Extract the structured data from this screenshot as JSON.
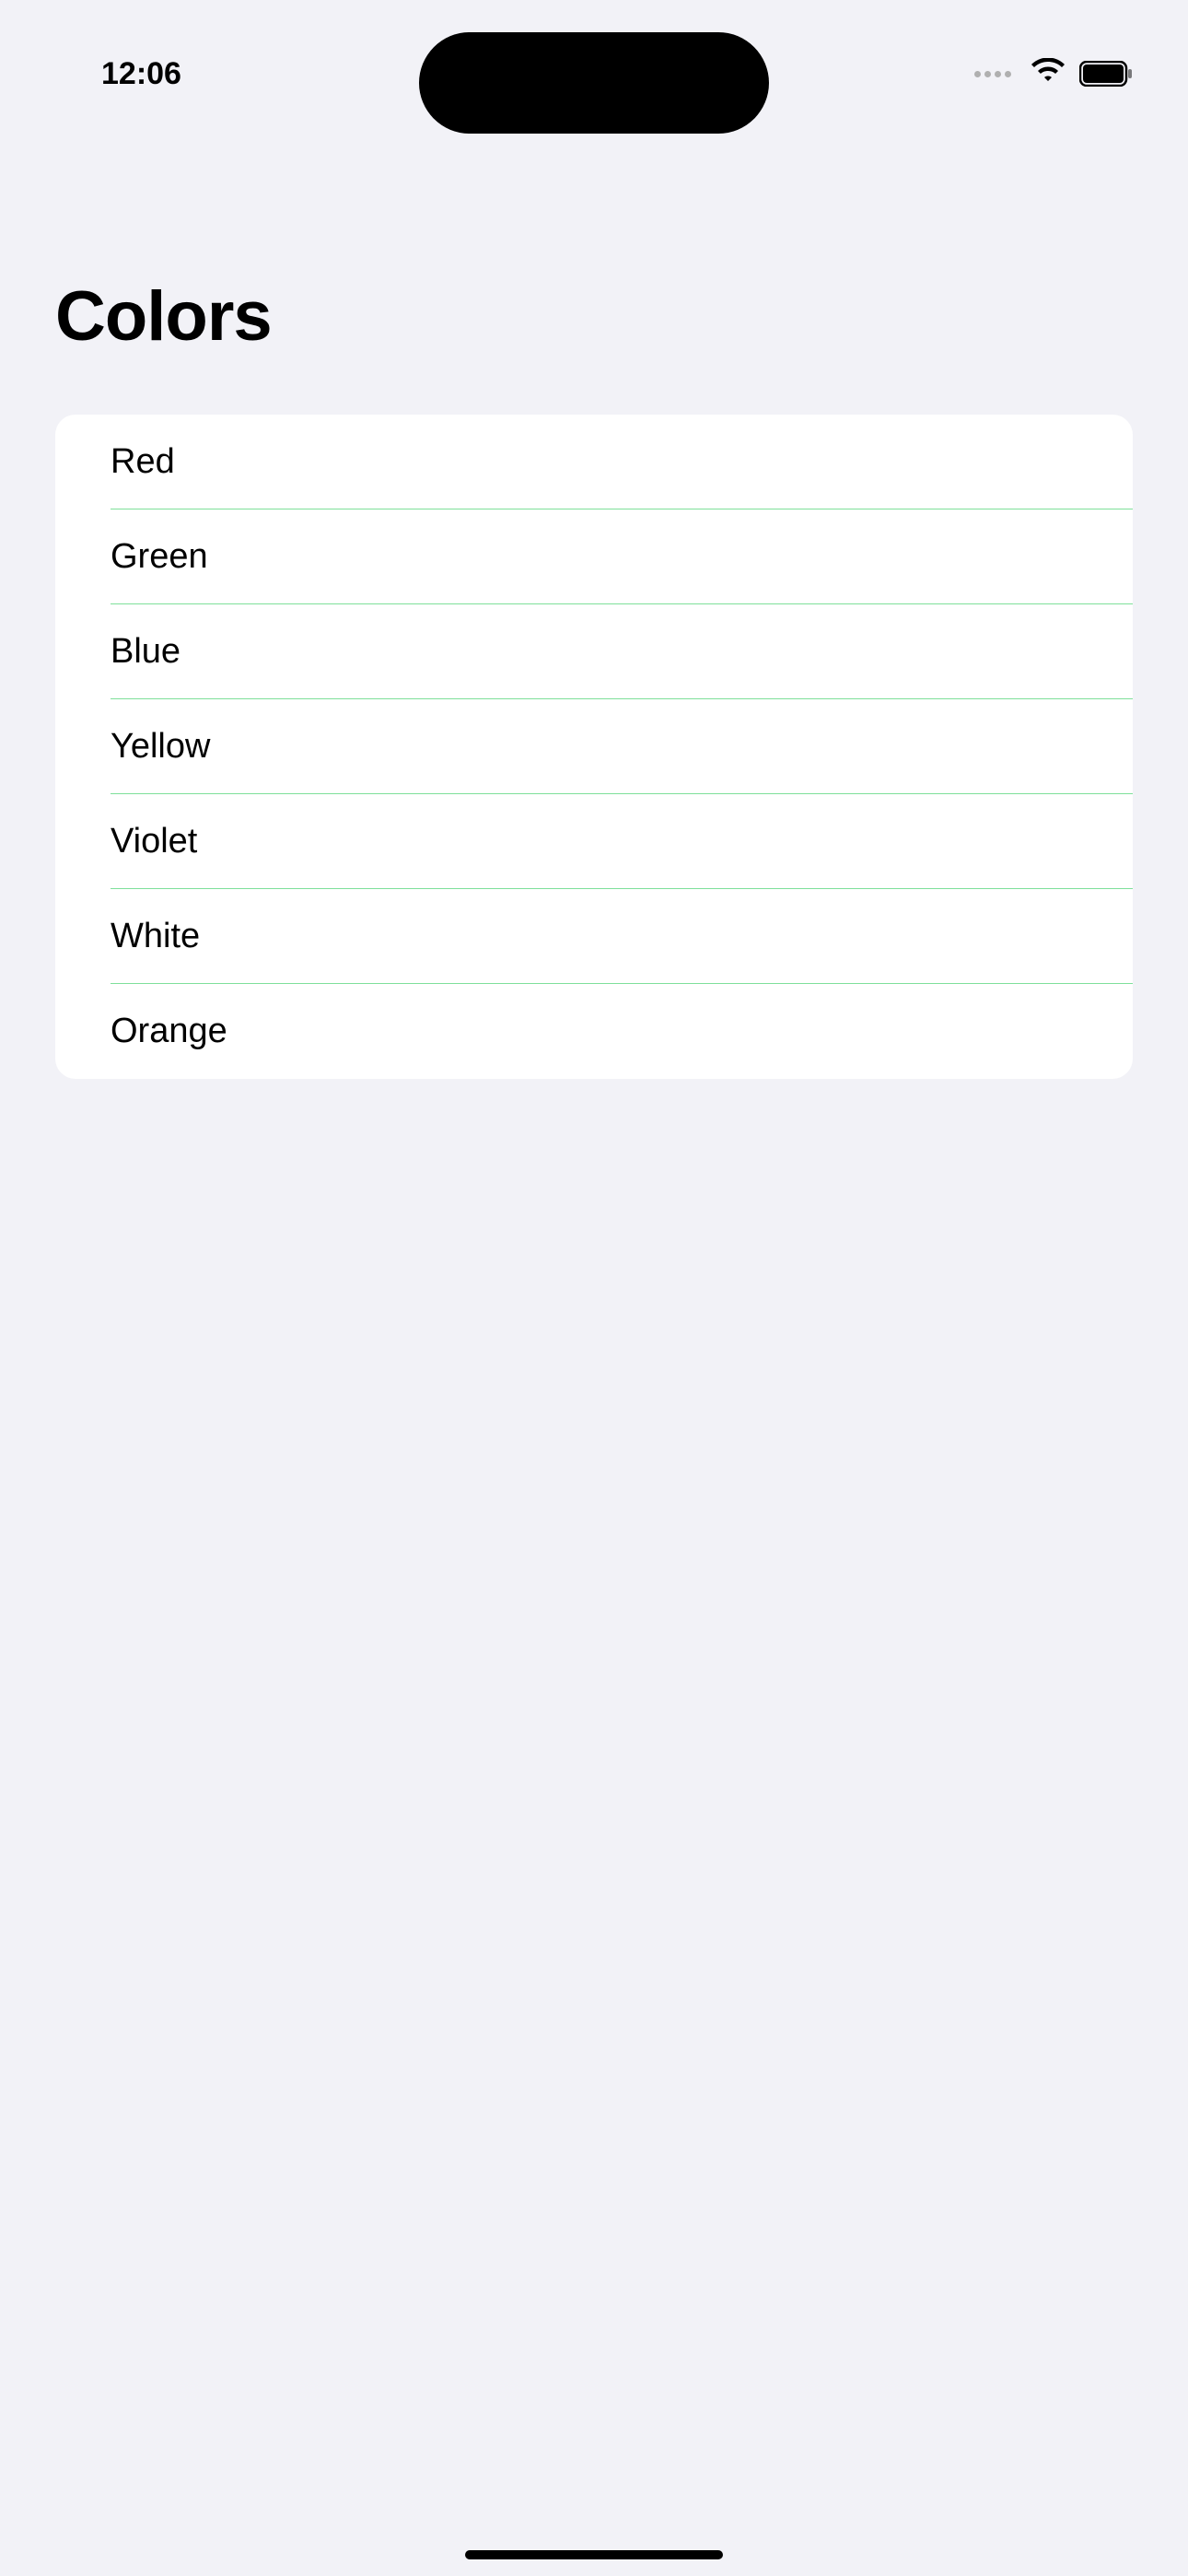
{
  "status_bar": {
    "time": "12:06"
  },
  "page": {
    "title": "Colors"
  },
  "list": {
    "items": [
      {
        "label": "Red"
      },
      {
        "label": "Green"
      },
      {
        "label": "Blue"
      },
      {
        "label": "Yellow"
      },
      {
        "label": "Violet"
      },
      {
        "label": "White"
      },
      {
        "label": "Orange"
      }
    ]
  }
}
